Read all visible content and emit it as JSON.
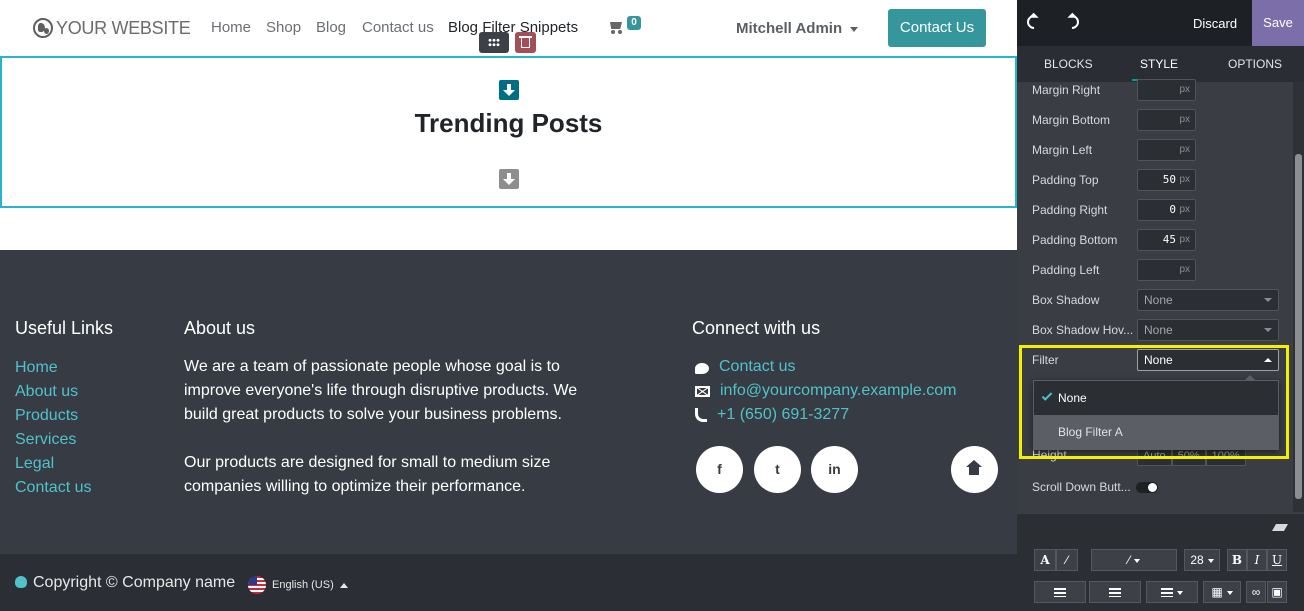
{
  "site": {
    "logo_text": "YOUR WEBSITE",
    "nav": [
      "Home",
      "Shop",
      "Blog",
      "Contact us"
    ],
    "nav_active": "Blog Filter Snippets",
    "cart_count": "0",
    "user_name": "Mitchell Admin",
    "contact_button": "Contact Us",
    "section_title": "Trending Posts",
    "footer": {
      "useful_links_title": "Useful Links",
      "useful_links": [
        "Home",
        "About us",
        "Products",
        "Services",
        "Legal",
        "Contact us"
      ],
      "about_title": "About us",
      "about_p1": "We are a team of passionate people whose goal is to improve everyone's life through disruptive products. We build great products to solve your business problems.",
      "about_p2": "Our products are designed for small to medium size companies willing to optimize their performance.",
      "connect_title": "Connect with us",
      "contact_link": "Contact us",
      "email": "info@yourcompany.example.com",
      "phone": "+1 (650) 691-3277",
      "social": [
        "f",
        "t",
        "in"
      ],
      "copyright": "Copyright © Company name",
      "language": "English (US)"
    }
  },
  "panel": {
    "discard": "Discard",
    "save": "Save",
    "tabs": [
      "BLOCKS",
      "STYLE",
      "OPTIONS"
    ],
    "active_tab": "STYLE",
    "rows": {
      "margin_right": {
        "label": "Margin Right",
        "value": "",
        "unit": "px"
      },
      "margin_bottom": {
        "label": "Margin Bottom",
        "value": "",
        "unit": "px"
      },
      "margin_left": {
        "label": "Margin Left",
        "value": "",
        "unit": "px"
      },
      "padding_top": {
        "label": "Padding Top",
        "value": "50",
        "unit": "px"
      },
      "padding_right": {
        "label": "Padding Right",
        "value": "0",
        "unit": "px"
      },
      "padding_bottom": {
        "label": "Padding Bottom",
        "value": "45",
        "unit": "px"
      },
      "padding_left": {
        "label": "Padding Left",
        "value": "",
        "unit": "px"
      }
    },
    "box_shadow": {
      "label": "Box Shadow",
      "value": "None"
    },
    "box_shadow_hover": {
      "label": "Box Shadow Hov...",
      "value": "None"
    },
    "filter": {
      "label": "Filter",
      "value": "None",
      "options": [
        "None",
        "Blog Filter A"
      ],
      "selected": "None"
    },
    "height": {
      "label": "Height",
      "options": [
        "Auto",
        "50%",
        "100%"
      ]
    },
    "scroll_down": {
      "label": "Scroll Down Butt..."
    },
    "toolbar": {
      "font_size": "28"
    },
    "colors": {
      "accent": "#35979c",
      "panel_bg": "#3a3d43",
      "highlight": "#f4f000",
      "save_bg": "#7c6ea8"
    }
  }
}
